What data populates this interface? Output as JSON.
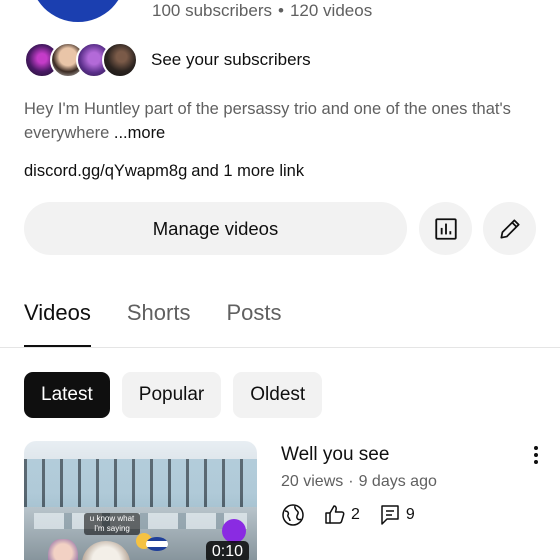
{
  "channel": {
    "subscribers": "100 subscribers",
    "videos_count": "120 videos",
    "see_subscribers": "See your subscribers",
    "bio": "Hey I'm Huntley part of the persassy trio and one of the ones that's everywhere",
    "bio_more": "...more",
    "link": "discord.gg/qYwapm8g",
    "more_links": "and 1 more link"
  },
  "actions": {
    "manage_videos": "Manage videos"
  },
  "tabs": [
    {
      "label": "Videos",
      "active": true
    },
    {
      "label": "Shorts",
      "active": false
    },
    {
      "label": "Posts",
      "active": false
    }
  ],
  "chips": [
    {
      "label": "Latest",
      "active": true
    },
    {
      "label": "Popular",
      "active": false
    },
    {
      "label": "Oldest",
      "active": false
    }
  ],
  "video": {
    "title": "Well you see",
    "views": "20 views",
    "age": "9 days ago",
    "duration": "0:10",
    "likes": "2",
    "comments": "9",
    "thumbnail_caption": "u know what I'm saying"
  },
  "icons": {
    "analytics": "bar-chart-icon",
    "edit": "pencil-icon",
    "visibility": "globe-icon",
    "like": "thumbs-up-icon",
    "comment": "comment-icon",
    "menu": "kebab-icon"
  },
  "colors": {
    "text_primary": "#0f0f0f",
    "text_secondary": "#606060",
    "chip_bg": "#f2f2f2",
    "avatar": "#1b3fb0"
  }
}
